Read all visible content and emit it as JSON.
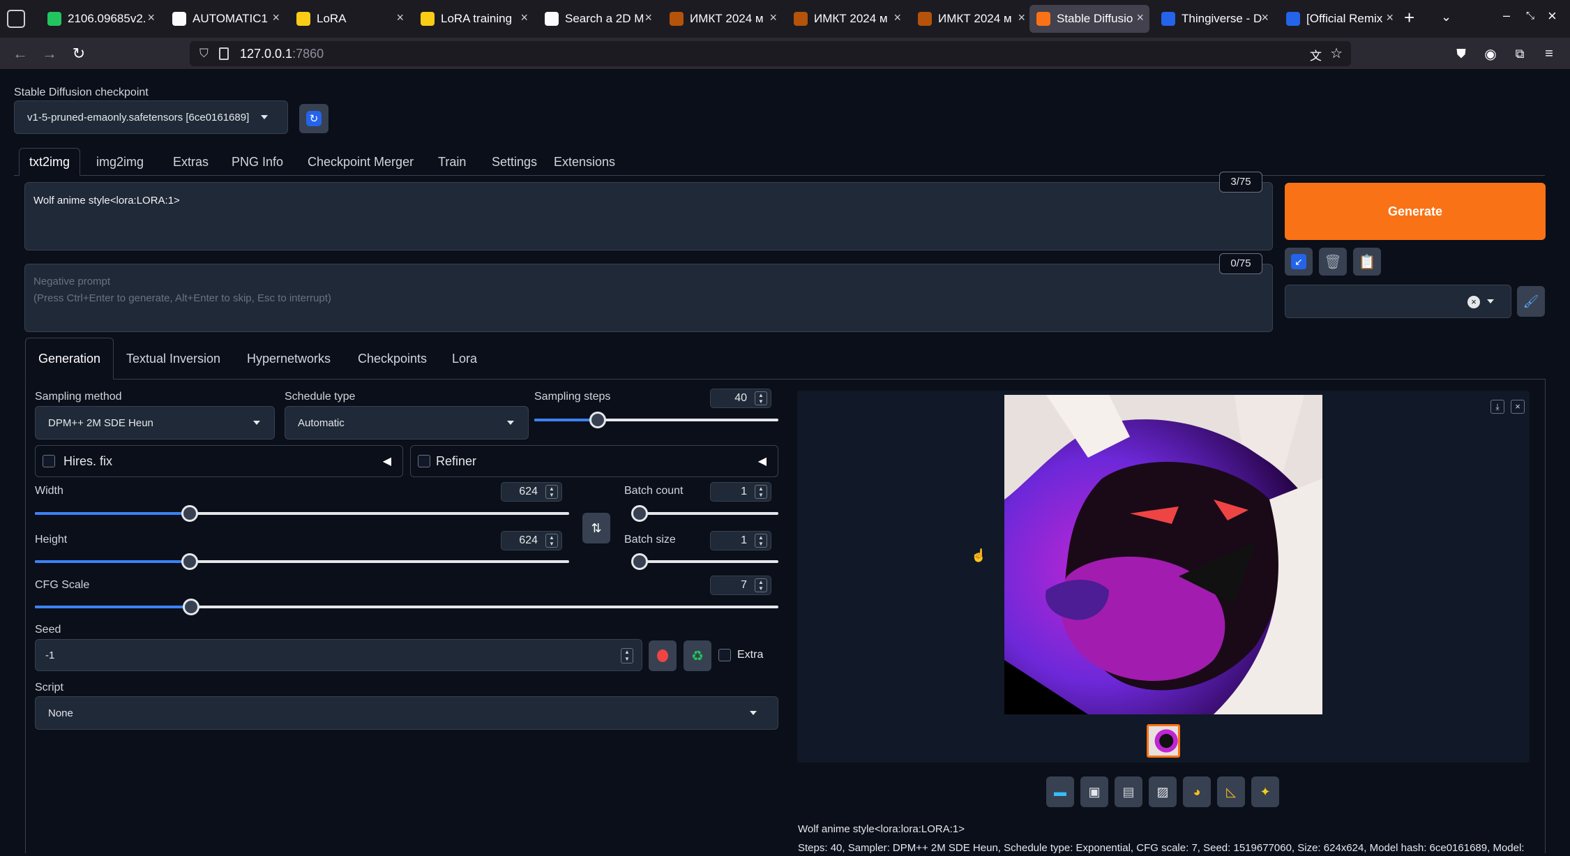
{
  "browser": {
    "tabs": [
      {
        "label": "2106.09685v2.",
        "icon": "arxiv-icon"
      },
      {
        "label": "AUTOMATIC1",
        "icon": "github-icon"
      },
      {
        "label": "LoRA",
        "icon": "huggingface-icon"
      },
      {
        "label": "LoRA training",
        "icon": "huggingface-icon"
      },
      {
        "label": "Search a 2D M",
        "icon": "search-icon"
      },
      {
        "label": "ИМКТ 2024 м",
        "icon": "imkt-icon"
      },
      {
        "label": "ИМКТ 2024 м",
        "icon": "imkt-icon"
      },
      {
        "label": "ИМКТ 2024 м",
        "icon": "imkt-icon"
      },
      {
        "label": "Stable Diffusio",
        "icon": "gradio-icon",
        "active": true
      },
      {
        "label": "Thingiverse - D",
        "icon": "thingiverse-icon"
      },
      {
        "label": "[Official Remix",
        "icon": "thingiverse-icon"
      }
    ],
    "url_host": "127.0.0.1",
    "url_port": ":7860"
  },
  "checkpoint": {
    "label": "Stable Diffusion checkpoint",
    "value": "v1-5-pruned-emaonly.safetensors [6ce0161689]"
  },
  "main_tabs": [
    "txt2img",
    "img2img",
    "Extras",
    "PNG Info",
    "Checkpoint Merger",
    "Train",
    "Settings",
    "Extensions"
  ],
  "prompt": {
    "value": "Wolf anime style<lora:LORA:1>",
    "counter": "3/75",
    "negative_placeholder_1": "Negative prompt",
    "negative_placeholder_2": "(Press Ctrl+Enter to generate, Alt+Enter to skip, Esc to interrupt)",
    "negative_counter": "0/75"
  },
  "generate_label": "Generate",
  "sub_tabs": [
    "Generation",
    "Textual Inversion",
    "Hypernetworks",
    "Checkpoints",
    "Lora"
  ],
  "params": {
    "sampling_method_label": "Sampling method",
    "sampling_method": "DPM++ 2M SDE Heun",
    "schedule_type_label": "Schedule type",
    "schedule_type": "Automatic",
    "sampling_steps_label": "Sampling steps",
    "sampling_steps": "40",
    "sampling_steps_frac": 0.26,
    "hires_label": "Hires. fix",
    "refiner_label": "Refiner",
    "width_label": "Width",
    "width": "624",
    "width_frac": 0.29,
    "height_label": "Height",
    "height": "624",
    "height_frac": 0.29,
    "batch_count_label": "Batch count",
    "batch_count": "1",
    "batch_count_frac": 0.0,
    "batch_size_label": "Batch size",
    "batch_size": "1",
    "batch_size_frac": 0.0,
    "cfg_label": "CFG Scale",
    "cfg": "7",
    "cfg_frac": 0.21,
    "seed_label": "Seed",
    "seed": "-1",
    "extra_label": "Extra",
    "script_label": "Script",
    "script": "None"
  },
  "output": {
    "prompt_line": "Wolf anime style<lora:lora:LORA:1>",
    "info_line": "Steps: 40, Sampler: DPM++ 2M SDE Heun, Schedule type: Exponential, CFG scale: 7, Seed: 1519677060, Size: 624x624, Model hash: 6ce0161689, Model:"
  },
  "colors": {
    "accent": "#f97316",
    "slider_fill": "#3b82f6",
    "background": "#0b0f19"
  }
}
